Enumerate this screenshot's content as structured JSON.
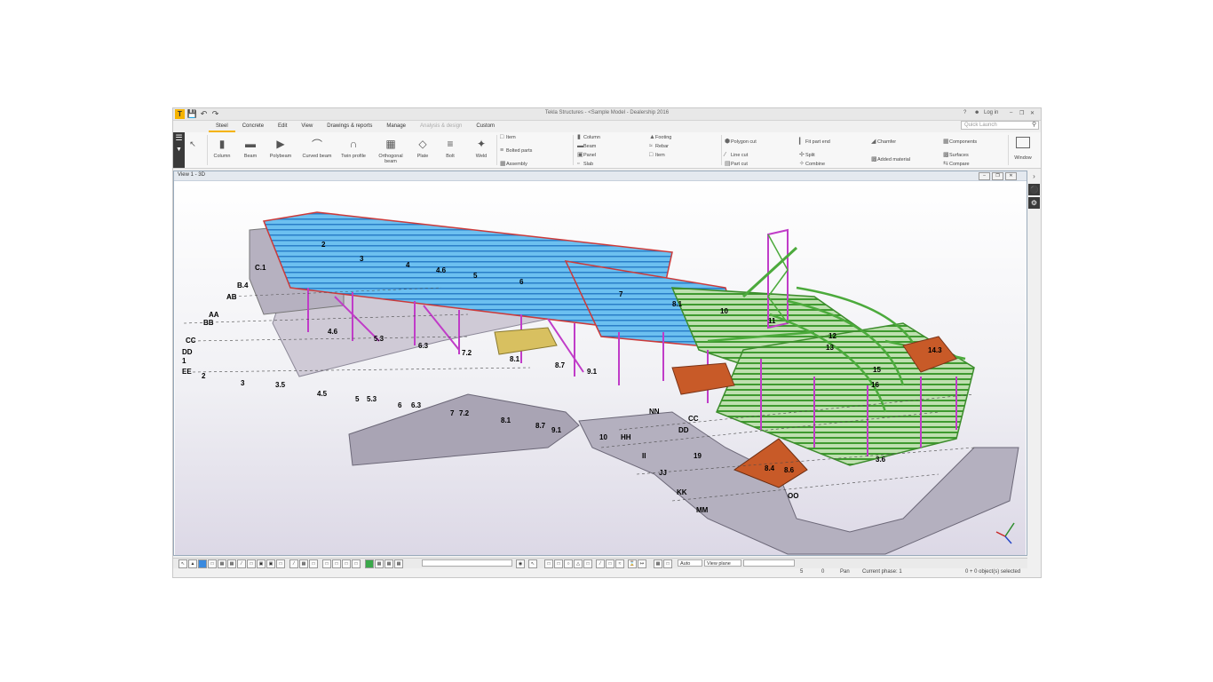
{
  "window": {
    "title": "Tekla Structures - <Sample Model - Dealership 2016"
  },
  "titlebar_right": {
    "help": "?",
    "login": "Log in"
  },
  "tabs": [
    "Steel",
    "Concrete",
    "Edit",
    "View",
    "Drawings & reports",
    "Manage",
    "Analysis & design",
    "Custom"
  ],
  "active_tab": "Steel",
  "search": {
    "placeholder": "Quick Launch"
  },
  "ribbon": {
    "big_buttons": [
      "Column",
      "Beam",
      "Polybeam",
      "Curved beam",
      "Twin profile",
      "Orthogonal beam",
      "Plate",
      "Bolt",
      "Weld"
    ],
    "item_group": [
      "Item",
      "Bolted parts",
      "Assembly"
    ],
    "concrete_group": [
      "Column",
      "Beam",
      "Panel",
      "Slab"
    ],
    "footing_group": [
      "Footing",
      "Rebar",
      "Item"
    ],
    "cut_group": [
      "Polygon cut",
      "Line cut",
      "Part cut"
    ],
    "fit_group": [
      "Fit part end",
      "Split",
      "Combine"
    ],
    "misc_group": [
      "Chamfer",
      "Added material"
    ],
    "comp_group": [
      "Components",
      "Surfaces",
      "Compare"
    ],
    "window_label": "Window"
  },
  "view": {
    "title": "View 1 - 3D"
  },
  "grid_labels": {
    "left": [
      "C.1",
      "B.4",
      "AB",
      "AA",
      "BB",
      "CC",
      "DD",
      "EE",
      "1",
      "2",
      "3",
      "3.5",
      "4.5",
      "5",
      "5.3",
      "6",
      "6.3",
      "7",
      "7.2",
      "8.1",
      "8.7",
      "9.1",
      "10",
      "HH",
      "II",
      "JJ",
      "KK",
      "MM",
      "NN",
      "OO",
      "DD",
      "CC"
    ],
    "top": [
      "2",
      "3",
      "4",
      "4.6",
      "5",
      "6",
      "7",
      "8.1",
      "10",
      "11",
      "12",
      "13",
      "14.3",
      "15",
      "16",
      "3.6",
      "4.6",
      "5.3",
      "6.3",
      "7.2",
      "8.1",
      "8.7",
      "9.1",
      "19",
      "8.4",
      "8.6"
    ]
  },
  "toolbar_bottom": {
    "combo1": "",
    "snap_mode": "Auto",
    "plane": "View plane",
    "combo3": ""
  },
  "status": {
    "val1": "5",
    "val2": "0",
    "mode": "Pan",
    "phase": "Current phase: 1",
    "selection": "0 + 0 object(s) selected"
  },
  "colors": {
    "accent": "#f5b300",
    "steel_green": "#4caa3c",
    "deck_blue": "#3aa0e8",
    "brace_magenta": "#c03cc8",
    "roof_orange": "#c85a28",
    "concrete": "#9e9aa8"
  }
}
